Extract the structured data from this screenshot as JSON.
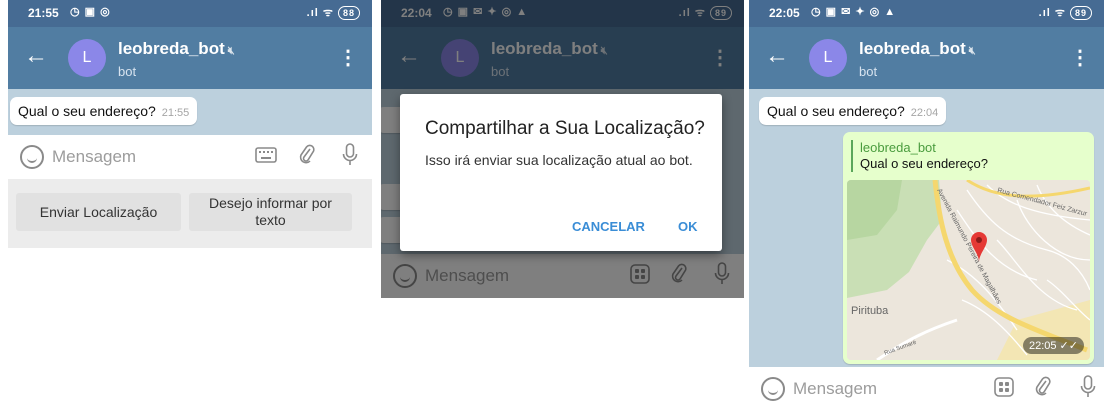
{
  "colors": {
    "header": "#517da2",
    "status": "#466b93",
    "chat_bg": "#bcd0dd",
    "accent": "#3a8dd6"
  },
  "screen1": {
    "status": {
      "time": "21:55",
      "icons": "◷ ▣ ◎",
      "right": ".ıl ᯤ",
      "battery": "88"
    },
    "header": {
      "avatar": "L",
      "name": "leobreda_bot",
      "subtitle": "bot"
    },
    "message": {
      "text": "Qual o seu endereço?",
      "time": "21:55"
    },
    "input": {
      "placeholder": "Mensagem"
    },
    "keyboard": {
      "btn1": "Enviar Localização",
      "btn2_line1": "Desejo informar por",
      "btn2_line2": "texto"
    }
  },
  "screen2": {
    "status": {
      "time": "22:04",
      "icons": "◷ ▣ ✉ ✦ ◎ ▲",
      "right": ".ıl ᯤ",
      "battery": "89"
    },
    "header": {
      "avatar": "L",
      "name": "leobreda_bot",
      "subtitle": "bot"
    },
    "dialog": {
      "title": "Compartilhar a Sua Localização?",
      "body": "Isso irá enviar sua localização atual ao bot.",
      "cancel": "CANCELAR",
      "ok": "OK"
    },
    "input": {
      "placeholder": "Mensagem"
    }
  },
  "screen3": {
    "status": {
      "time": "22:05",
      "icons": "◷ ▣ ✉ ✦ ◎ ▲",
      "right": ".ıl ᯤ",
      "battery": "89"
    },
    "header": {
      "avatar": "L",
      "name": "leobreda_bot",
      "subtitle": "bot"
    },
    "message": {
      "text": "Qual o seu endereço?",
      "time": "22:04"
    },
    "reply": {
      "name": "leobreda_bot",
      "text": "Qual o seu endereço?",
      "time": "22:05 ✓✓"
    },
    "map_labels": {
      "pirituba": "Pirituba",
      "street1": "Rua Comendador Feiz Zarzur",
      "street2": "Avenida Raimundo Pereira de Magalhães",
      "street3": "Rua Sumaré"
    },
    "input": {
      "placeholder": "Mensagem"
    }
  }
}
